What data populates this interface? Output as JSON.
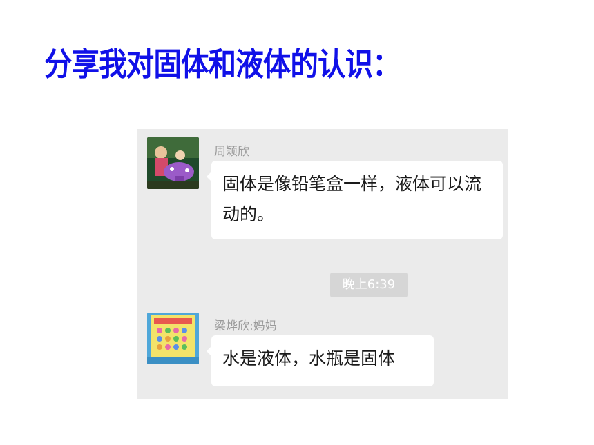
{
  "slide": {
    "title": "分享我对固体和液体的认识："
  },
  "chat": {
    "messages": [
      {
        "sender": "周颖欣",
        "text": "固体是像铅笔盒一样，液体可以流动的。",
        "avatar_icon": "child-photo-avatar"
      },
      {
        "sender": "梁烨欣:妈妈",
        "text": "水是液体，水瓶是固体",
        "avatar_icon": "poster-photo-avatar"
      }
    ],
    "timestamp": "晚上6:39"
  },
  "colors": {
    "title": "#1010e8",
    "panel_bg": "#ebebeb",
    "bubble_bg": "#ffffff",
    "sender_text": "#9a9a9a",
    "time_chip_bg": "#d6d6d6"
  }
}
